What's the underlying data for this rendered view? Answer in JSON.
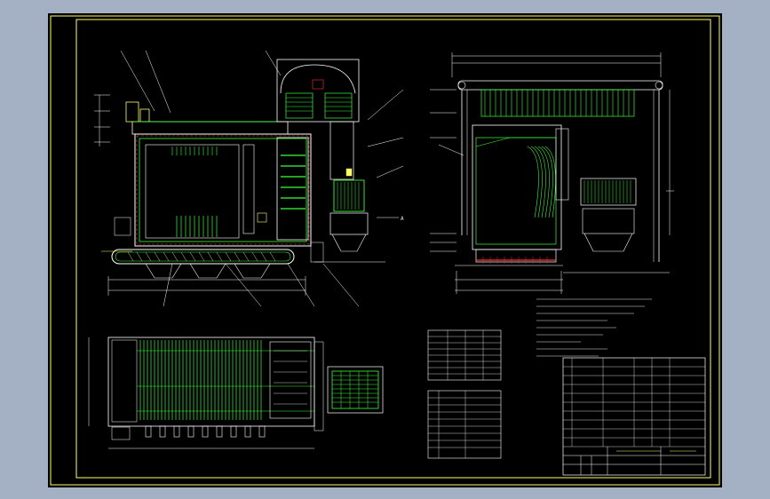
{
  "drawing": {
    "background": "#a4b1c4",
    "sheet_color": "#000000",
    "frame_color": "#ffff66",
    "line_color": "#ffffff",
    "tube_color": "#33ff33",
    "accent_color": "#ff3333",
    "cyan_color": "#66ffff"
  },
  "section_marker": "A",
  "parts_list_rows": 12,
  "notes_lines": 9
}
